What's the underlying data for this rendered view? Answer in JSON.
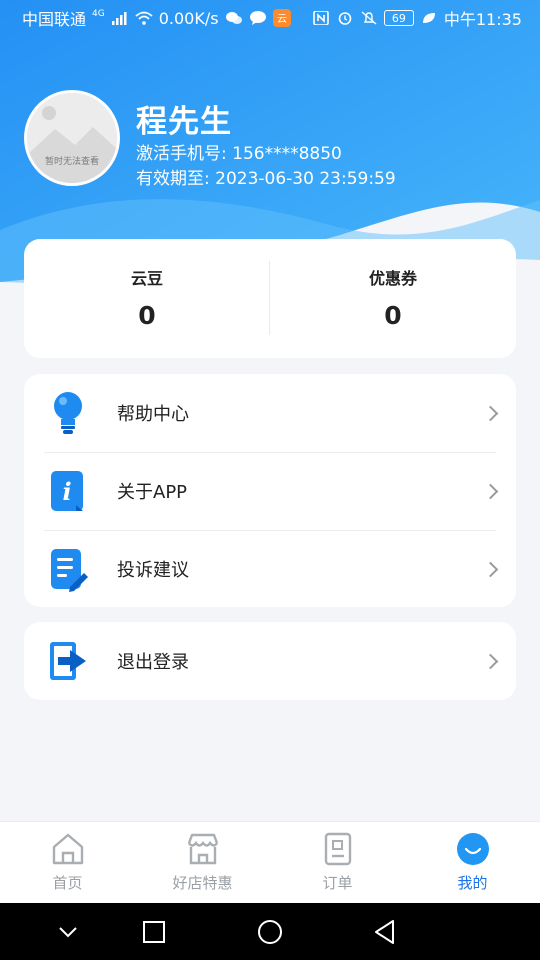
{
  "status_bar": {
    "carrier": "中国联通",
    "network": "4G",
    "speed": "0.00K/s",
    "battery": "69",
    "time": "中午11:35"
  },
  "profile": {
    "avatar_text": "暂时无法查看",
    "name": "程先生",
    "phone_label": "激活手机号:",
    "phone": "156****8850",
    "expiry_label": "有效期至:",
    "expiry": "2023-06-30 23:59:59"
  },
  "stats": [
    {
      "label": "云豆",
      "value": "0"
    },
    {
      "label": "优惠券",
      "value": "0"
    }
  ],
  "menu": [
    {
      "label": "帮助中心",
      "icon": "lightbulb-icon"
    },
    {
      "label": "关于APP",
      "icon": "info-icon"
    },
    {
      "label": "投诉建议",
      "icon": "document-edit-icon"
    }
  ],
  "logout": {
    "label": "退出登录",
    "icon": "logout-icon"
  },
  "tabs": [
    {
      "label": "首页",
      "icon": "home-icon",
      "active": false
    },
    {
      "label": "好店特惠",
      "icon": "store-icon",
      "active": false
    },
    {
      "label": "订单",
      "icon": "order-icon",
      "active": false
    },
    {
      "label": "我的",
      "icon": "profile-icon",
      "active": true
    }
  ],
  "colors": {
    "primary": "#1a73e8",
    "header_gradient_start": "#1e8cf5",
    "header_gradient_end": "#3aa9f8",
    "inactive": "#9aa0a6"
  }
}
